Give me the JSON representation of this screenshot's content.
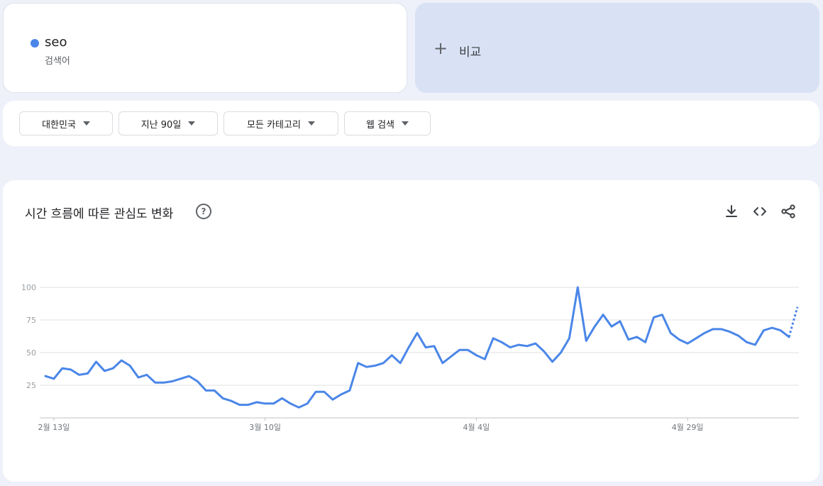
{
  "term": {
    "name": "seo",
    "type": "검색어",
    "color": "#4a86e8"
  },
  "compare": {
    "plus": "+",
    "label": "비교"
  },
  "filters": [
    {
      "label": "대한민국"
    },
    {
      "label": "지난 90일"
    },
    {
      "label": "모든 카테고리"
    },
    {
      "label": "웹 검색"
    }
  ],
  "chart_title": "시간 흐름에 따른 관심도 변화",
  "help_icon_glyph": "?",
  "icons": [
    "download-icon",
    "embed-code-icon",
    "share-icon"
  ],
  "chart_data": {
    "type": "line",
    "x_start": "2025-02-12",
    "x_end": "2025-05-12",
    "ylim": [
      0,
      100
    ],
    "yticks": [
      25,
      50,
      75,
      100
    ],
    "xticks": [
      "2월 13일",
      "3월 10일",
      "4월 4일",
      "4월 29일"
    ],
    "grid": true,
    "series": [
      {
        "name": "seo",
        "color": "#4a86e8",
        "values": [
          32,
          30,
          38,
          37,
          33,
          34,
          43,
          36,
          38,
          44,
          40,
          31,
          33,
          27,
          27,
          28,
          30,
          32,
          28,
          21,
          21,
          15,
          13,
          10,
          10,
          12,
          11,
          11,
          15,
          11,
          8,
          11,
          20,
          20,
          14,
          18,
          21,
          42,
          39,
          40,
          42,
          48,
          42,
          54,
          65,
          54,
          55,
          42,
          47,
          52,
          52,
          48,
          45,
          61,
          58,
          54,
          56,
          55,
          57,
          51,
          43,
          50,
          61,
          100,
          59,
          70,
          79,
          70,
          74,
          60,
          62,
          58,
          77,
          79,
          65,
          60,
          57,
          61,
          65,
          68,
          68,
          66,
          63,
          58,
          56,
          67,
          69,
          67,
          62,
          85
        ],
        "partial_last_point": true
      }
    ]
  }
}
